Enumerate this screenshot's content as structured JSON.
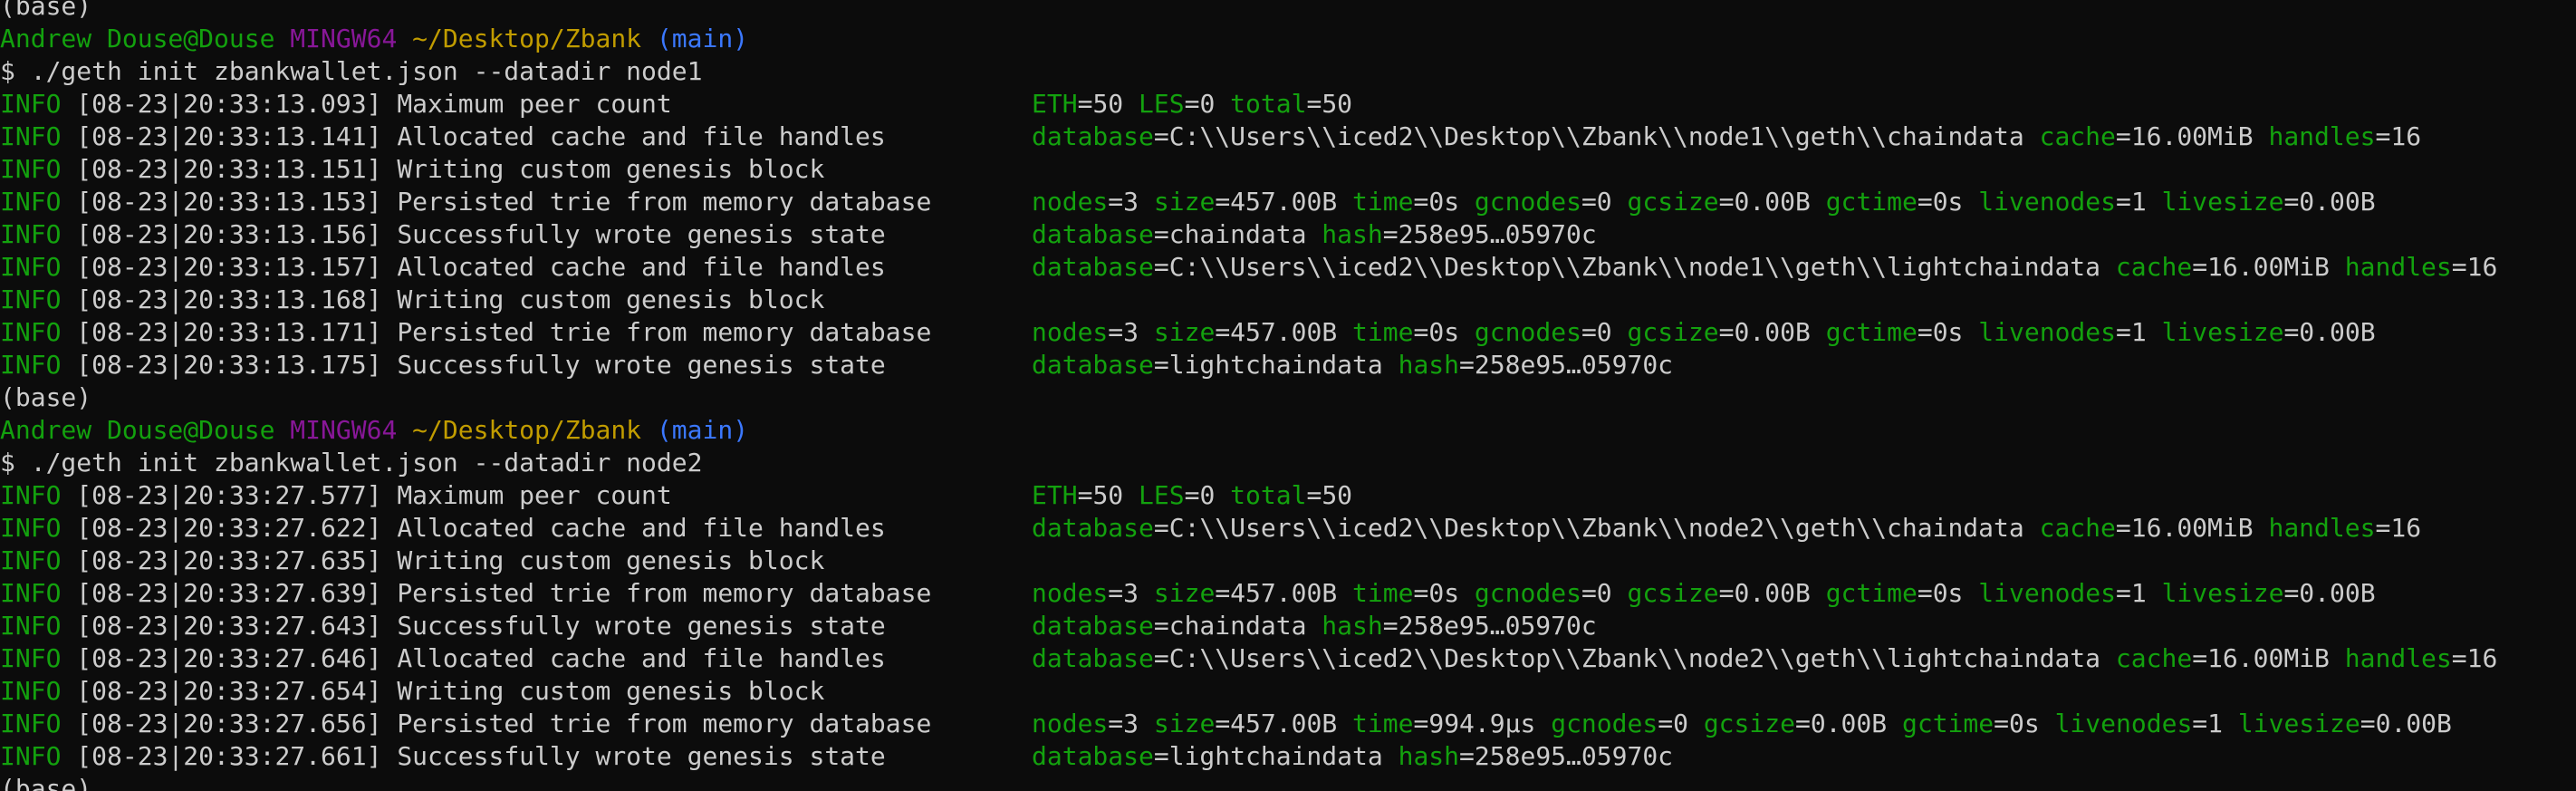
{
  "colors": {
    "background": "#0c0c0c",
    "default_text": "#cccccc",
    "info_green": "#13a10e",
    "msystem_magenta": "#881798",
    "path_yellow": "#c19c00",
    "branch_blue": "#3b78ff"
  },
  "lines": [
    {
      "type": "text",
      "parts": [
        {
          "t": "(base)",
          "c": "default"
        }
      ]
    },
    {
      "type": "prompt",
      "user": "Andrew Douse@Douse",
      "msys": "MINGW64",
      "path": "~/Desktop/Zbank",
      "branch": "(main)"
    },
    {
      "type": "text",
      "parts": [
        {
          "t": "$ ./geth init zbankwallet.json --datadir node1",
          "c": "default"
        }
      ]
    },
    {
      "type": "log",
      "level": "INFO",
      "ts": "[08-23|20:33:13.093]",
      "msg": "Maximum peer count",
      "ctx": [
        {
          "k": "ETH",
          "v": "50"
        },
        {
          "k": "LES",
          "v": "0"
        },
        {
          "k": "total",
          "v": "50"
        }
      ]
    },
    {
      "type": "log",
      "level": "INFO",
      "ts": "[08-23|20:33:13.141]",
      "msg": "Allocated cache and file handles",
      "ctx": [
        {
          "k": "database",
          "v": "C:\\\\Users\\\\iced2\\\\Desktop\\\\Zbank\\\\node1\\\\geth\\\\chaindata"
        },
        {
          "k": "cache",
          "v": "16.00MiB"
        },
        {
          "k": "handles",
          "v": "16"
        }
      ]
    },
    {
      "type": "log",
      "level": "INFO",
      "ts": "[08-23|20:33:13.151]",
      "msg": "Writing custom genesis block",
      "ctx": []
    },
    {
      "type": "log",
      "level": "INFO",
      "ts": "[08-23|20:33:13.153]",
      "msg": "Persisted trie from memory database",
      "ctx": [
        {
          "k": "nodes",
          "v": "3"
        },
        {
          "k": "size",
          "v": "457.00B"
        },
        {
          "k": "time",
          "v": "0s"
        },
        {
          "k": "gcnodes",
          "v": "0"
        },
        {
          "k": "gcsize",
          "v": "0.00B"
        },
        {
          "k": "gctime",
          "v": "0s"
        },
        {
          "k": "livenodes",
          "v": "1"
        },
        {
          "k": "livesize",
          "v": "0.00B"
        }
      ]
    },
    {
      "type": "log",
      "level": "INFO",
      "ts": "[08-23|20:33:13.156]",
      "msg": "Successfully wrote genesis state",
      "ctx": [
        {
          "k": "database",
          "v": "chaindata"
        },
        {
          "k": "hash",
          "v": "258e95…05970c"
        }
      ]
    },
    {
      "type": "log",
      "level": "INFO",
      "ts": "[08-23|20:33:13.157]",
      "msg": "Allocated cache and file handles",
      "ctx": [
        {
          "k": "database",
          "v": "C:\\\\Users\\\\iced2\\\\Desktop\\\\Zbank\\\\node1\\\\geth\\\\lightchaindata"
        },
        {
          "k": "cache",
          "v": "16.00MiB"
        },
        {
          "k": "handles",
          "v": "16"
        }
      ]
    },
    {
      "type": "log",
      "level": "INFO",
      "ts": "[08-23|20:33:13.168]",
      "msg": "Writing custom genesis block",
      "ctx": []
    },
    {
      "type": "log",
      "level": "INFO",
      "ts": "[08-23|20:33:13.171]",
      "msg": "Persisted trie from memory database",
      "ctx": [
        {
          "k": "nodes",
          "v": "3"
        },
        {
          "k": "size",
          "v": "457.00B"
        },
        {
          "k": "time",
          "v": "0s"
        },
        {
          "k": "gcnodes",
          "v": "0"
        },
        {
          "k": "gcsize",
          "v": "0.00B"
        },
        {
          "k": "gctime",
          "v": "0s"
        },
        {
          "k": "livenodes",
          "v": "1"
        },
        {
          "k": "livesize",
          "v": "0.00B"
        }
      ]
    },
    {
      "type": "log",
      "level": "INFO",
      "ts": "[08-23|20:33:13.175]",
      "msg": "Successfully wrote genesis state",
      "ctx": [
        {
          "k": "database",
          "v": "lightchaindata"
        },
        {
          "k": "hash",
          "v": "258e95…05970c"
        }
      ]
    },
    {
      "type": "text",
      "parts": [
        {
          "t": "(base)",
          "c": "default"
        }
      ]
    },
    {
      "type": "prompt",
      "user": "Andrew Douse@Douse",
      "msys": "MINGW64",
      "path": "~/Desktop/Zbank",
      "branch": "(main)"
    },
    {
      "type": "text",
      "parts": [
        {
          "t": "$ ./geth init zbankwallet.json --datadir node2",
          "c": "default"
        }
      ]
    },
    {
      "type": "log",
      "level": "INFO",
      "ts": "[08-23|20:33:27.577]",
      "msg": "Maximum peer count",
      "ctx": [
        {
          "k": "ETH",
          "v": "50"
        },
        {
          "k": "LES",
          "v": "0"
        },
        {
          "k": "total",
          "v": "50"
        }
      ]
    },
    {
      "type": "log",
      "level": "INFO",
      "ts": "[08-23|20:33:27.622]",
      "msg": "Allocated cache and file handles",
      "ctx": [
        {
          "k": "database",
          "v": "C:\\\\Users\\\\iced2\\\\Desktop\\\\Zbank\\\\node2\\\\geth\\\\chaindata"
        },
        {
          "k": "cache",
          "v": "16.00MiB"
        },
        {
          "k": "handles",
          "v": "16"
        }
      ]
    },
    {
      "type": "log",
      "level": "INFO",
      "ts": "[08-23|20:33:27.635]",
      "msg": "Writing custom genesis block",
      "ctx": []
    },
    {
      "type": "log",
      "level": "INFO",
      "ts": "[08-23|20:33:27.639]",
      "msg": "Persisted trie from memory database",
      "ctx": [
        {
          "k": "nodes",
          "v": "3"
        },
        {
          "k": "size",
          "v": "457.00B"
        },
        {
          "k": "time",
          "v": "0s"
        },
        {
          "k": "gcnodes",
          "v": "0"
        },
        {
          "k": "gcsize",
          "v": "0.00B"
        },
        {
          "k": "gctime",
          "v": "0s"
        },
        {
          "k": "livenodes",
          "v": "1"
        },
        {
          "k": "livesize",
          "v": "0.00B"
        }
      ]
    },
    {
      "type": "log",
      "level": "INFO",
      "ts": "[08-23|20:33:27.643]",
      "msg": "Successfully wrote genesis state",
      "ctx": [
        {
          "k": "database",
          "v": "chaindata"
        },
        {
          "k": "hash",
          "v": "258e95…05970c"
        }
      ]
    },
    {
      "type": "log",
      "level": "INFO",
      "ts": "[08-23|20:33:27.646]",
      "msg": "Allocated cache and file handles",
      "ctx": [
        {
          "k": "database",
          "v": "C:\\\\Users\\\\iced2\\\\Desktop\\\\Zbank\\\\node2\\\\geth\\\\lightchaindata"
        },
        {
          "k": "cache",
          "v": "16.00MiB"
        },
        {
          "k": "handles",
          "v": "16"
        }
      ]
    },
    {
      "type": "log",
      "level": "INFO",
      "ts": "[08-23|20:33:27.654]",
      "msg": "Writing custom genesis block",
      "ctx": []
    },
    {
      "type": "log",
      "level": "INFO",
      "ts": "[08-23|20:33:27.656]",
      "msg": "Persisted trie from memory database",
      "ctx": [
        {
          "k": "nodes",
          "v": "3"
        },
        {
          "k": "size",
          "v": "457.00B"
        },
        {
          "k": "time",
          "v": "994.9µs"
        },
        {
          "k": "gcnodes",
          "v": "0"
        },
        {
          "k": "gcsize",
          "v": "0.00B"
        },
        {
          "k": "gctime",
          "v": "0s"
        },
        {
          "k": "livenodes",
          "v": "1"
        },
        {
          "k": "livesize",
          "v": "0.00B"
        }
      ]
    },
    {
      "type": "log",
      "level": "INFO",
      "ts": "[08-23|20:33:27.661]",
      "msg": "Successfully wrote genesis state",
      "ctx": [
        {
          "k": "database",
          "v": "lightchaindata"
        },
        {
          "k": "hash",
          "v": "258e95…05970c"
        }
      ]
    },
    {
      "type": "text",
      "parts": [
        {
          "t": "(base)",
          "c": "default"
        }
      ]
    }
  ]
}
